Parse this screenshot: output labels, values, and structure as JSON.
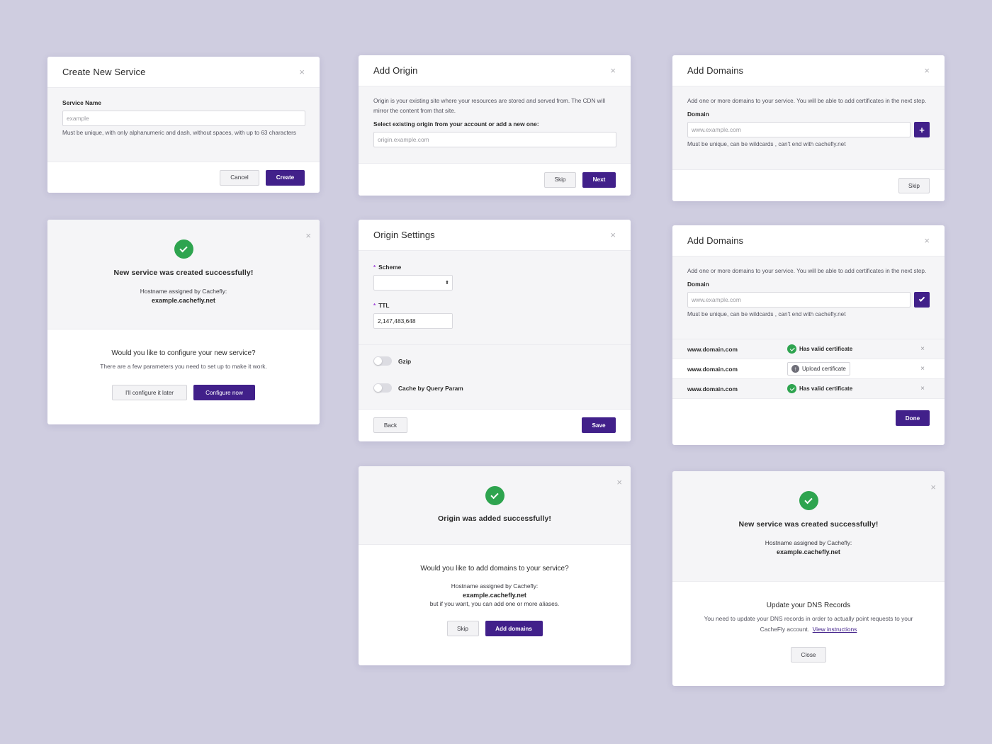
{
  "create_service": {
    "title": "Create New Service",
    "name_label": "Service Name",
    "name_placeholder": "example",
    "name_help": "Must be unique, with only alphanumeric and dash, without spaces, with up to 63 characters",
    "cancel": "Cancel",
    "create": "Create"
  },
  "add_origin": {
    "title": "Add Origin",
    "desc": "Origin is your existing site where your resources are stored and served from. The CDN will mirror the content from that site.",
    "select_label": "Select existing origin from your account or add a new one:",
    "origin_placeholder": "origin.example.com",
    "skip": "Skip",
    "next": "Next"
  },
  "add_domains_1": {
    "title": "Add Domains",
    "desc": "Add one or more domains to your service. You will be able to add certificates in the next step.",
    "domain_label": "Domain",
    "domain_placeholder": "www.example.com",
    "plus": "+",
    "help": "Must be unique, can be wildcards , can't end with cachefly.net",
    "skip": "Skip"
  },
  "service_success": {
    "title": "New service was created successfully!",
    "hostname_label": "Hostname assigned by Cachefly:",
    "hostname": "example.cachefly.net",
    "question": "Would you like to configure your new service?",
    "sub": "There are a few parameters you need to set up to make it work.",
    "later": "I'll configure it later",
    "now": "Configure now"
  },
  "origin_settings": {
    "title": "Origin Settings",
    "req": "*",
    "scheme_label": "Scheme",
    "ttl_label": "TTL",
    "ttl_value": "2,147,483,648",
    "gzip_label": "Gzip",
    "cache_label": "Cache by Query Param",
    "back": "Back",
    "save": "Save"
  },
  "add_domains_2": {
    "title": "Add Domains",
    "desc": "Add one or more domains to your service. You will be able to add certificates in the next step.",
    "domain_label": "Domain",
    "domain_placeholder": "www.example.com",
    "help": "Must be unique, can be wildcards , can't end with cachefly.net",
    "rows": [
      {
        "domain": "www.domain.com",
        "status": "Has valid certificate"
      },
      {
        "domain": "www.domain.com",
        "status": "Upload certificate"
      },
      {
        "domain": "www.domain.com",
        "status": "Has valid certificate"
      }
    ],
    "done": "Done"
  },
  "origin_success": {
    "title": "Origin was added successfully!",
    "question": "Would you like to add domains to your service?",
    "hostname_label": "Hostname assigned by Cachefly:",
    "hostname": "example.cachefly.net",
    "aliases": "but if you want, you can add one or more aliases.",
    "skip": "Skip",
    "add": "Add domains"
  },
  "dns_success": {
    "title": "New service was created successfully!",
    "hostname_label": "Hostname assigned by Cachefly:",
    "hostname": "example.cachefly.net",
    "dns_title": "Update your DNS Records",
    "dns_text": "You need to update your DNS records in order to actually point requests to your CacheFly account.",
    "link": "View instructions",
    "close": "Close"
  },
  "close_glyph": "×",
  "colors": {
    "background": "#cfcde0",
    "primary": "#41208a",
    "success": "#2ea44f",
    "required": "#9c3bd8"
  }
}
